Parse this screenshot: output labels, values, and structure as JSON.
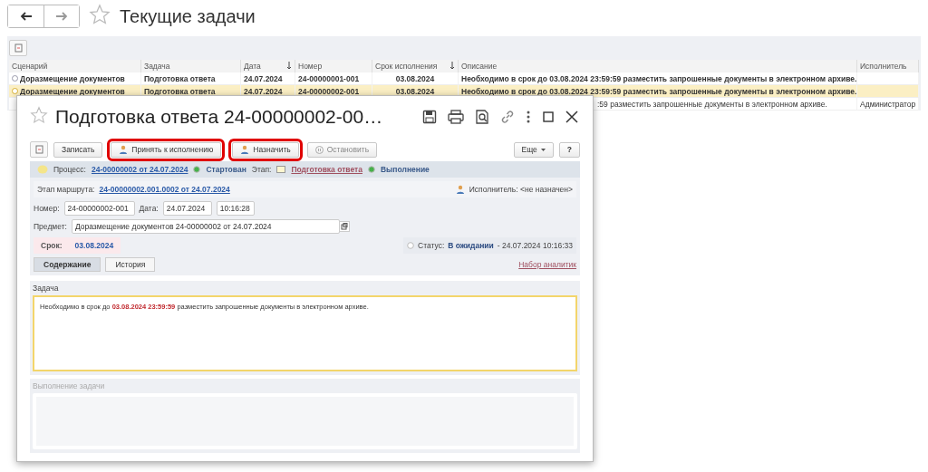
{
  "page": {
    "title": "Текущие задачи",
    "favorite": false
  },
  "table": {
    "columns": [
      {
        "label": "Сценарий",
        "sort": false
      },
      {
        "label": "Задача",
        "sort": false
      },
      {
        "label": "Дата",
        "sort": true
      },
      {
        "label": "Номер",
        "sort": false
      },
      {
        "label": "Срок исполнения",
        "sort": true
      },
      {
        "label": "Описание",
        "sort": false
      },
      {
        "label": "Исполнитель",
        "sort": false
      }
    ],
    "rows": [
      {
        "selected": false,
        "bold": true,
        "cells": [
          "Доразмещение документов",
          "Подготовка ответа",
          "24.07.2024",
          "24-00000001-001",
          "03.08.2024",
          "Необходимо в срок до 03.08.2024 23:59:59 разместить запрошенные документы в электронном архиве.",
          ""
        ]
      },
      {
        "selected": true,
        "bold": true,
        "cells": [
          "Доразмещение документов",
          "Подготовка ответа",
          "24.07.2024",
          "24-00000002-001",
          "03.08.2024",
          "Необходимо в срок до 03.08.2024 23:59:59 разместить запрошенные документы в электронном архиве.",
          ""
        ]
      },
      {
        "selected": false,
        "bold": false,
        "clipped": true,
        "cells": [
          "",
          "",
          "",
          "",
          "",
          ":59 разместить запрошенные документы в электронном архиве.",
          "Администратор"
        ]
      }
    ]
  },
  "dialog": {
    "title": "Подготовка ответа 24-00000002-00…",
    "favorite": false,
    "toolbar": [
      {
        "label": "Записать",
        "kind": "plain",
        "highlighted": false,
        "disabled": false
      },
      {
        "label": "Принять к исполнению",
        "kind": "accept",
        "highlighted": true,
        "disabled": false
      },
      {
        "label": "Назначить",
        "kind": "assign",
        "highlighted": true,
        "disabled": false
      },
      {
        "label": "Остановить",
        "kind": "stop",
        "highlighted": false,
        "disabled": true
      }
    ],
    "more": "Еще",
    "help": "?",
    "process": {
      "label": "Процесс:",
      "link": "24-00000002 от 24.07.2024",
      "state": "Стартован",
      "stage_label": "Этап:",
      "stage_link": "Подготовка ответа",
      "stage_state": "Выполнение"
    },
    "route": {
      "label": "Этап маршрута:",
      "link": "24-00000002.001.0002 от 24.07.2024",
      "executor": "Исполнитель: <не назначен>"
    },
    "number": {
      "label": "Номер:",
      "value": "24-00000002-001",
      "date_label": "Дата:",
      "date": "24.07.2024",
      "time": "10:16:28"
    },
    "subject": {
      "label": "Предмет:",
      "value": "Доразмещение документов 24-00000002 от 24.07.2024"
    },
    "deadline": {
      "label": "Срок:",
      "value": "03.08.2024"
    },
    "status": {
      "label": "Статус:",
      "value": "В ожидании",
      "time": "- 24.07.2024 10:16:33"
    },
    "tabs": [
      {
        "label": "Содержание",
        "selected": true
      },
      {
        "label": "История",
        "selected": false
      }
    ],
    "analytics": "Набор аналитик",
    "task": {
      "label": "Задача",
      "before": "Необходимо в срок до",
      "deadline": "03.08.2024 23:59:59",
      "after": "разместить запрошенные документы в электронном архиве."
    },
    "execution": {
      "label": "Выполнение задачи"
    }
  }
}
